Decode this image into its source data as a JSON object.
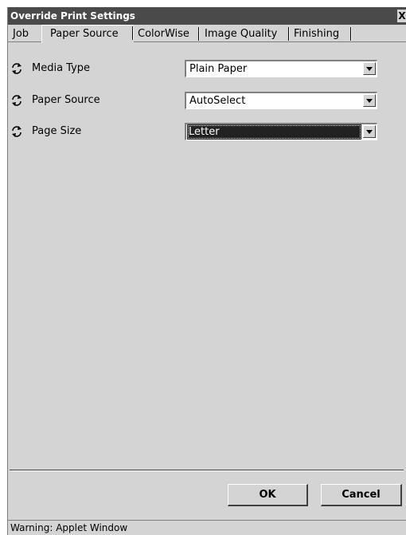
{
  "window": {
    "title": "Override Print Settings",
    "close_label": "X"
  },
  "tabs": [
    {
      "label": "Job",
      "active": false
    },
    {
      "label": "Paper Source",
      "active": true
    },
    {
      "label": "ColorWise",
      "active": false
    },
    {
      "label": "Image Quality",
      "active": false
    },
    {
      "label": "Finishing",
      "active": false
    }
  ],
  "settings": [
    {
      "label": "Media Type",
      "value": "Plain Paper",
      "icon": "refresh-icon",
      "selected": false
    },
    {
      "label": "Paper Source",
      "value": "AutoSelect",
      "icon": "refresh-icon",
      "selected": false
    },
    {
      "label": "Page Size",
      "value": "Letter",
      "icon": "refresh-icon",
      "selected": true
    }
  ],
  "buttons": {
    "ok_label": "OK",
    "cancel_label": "Cancel"
  },
  "status": {
    "text": "Warning: Applet Window"
  },
  "colors": {
    "titlebar": "#4a4a4a",
    "dialog_bg": "#d4d4d4",
    "selection": "#222222"
  }
}
